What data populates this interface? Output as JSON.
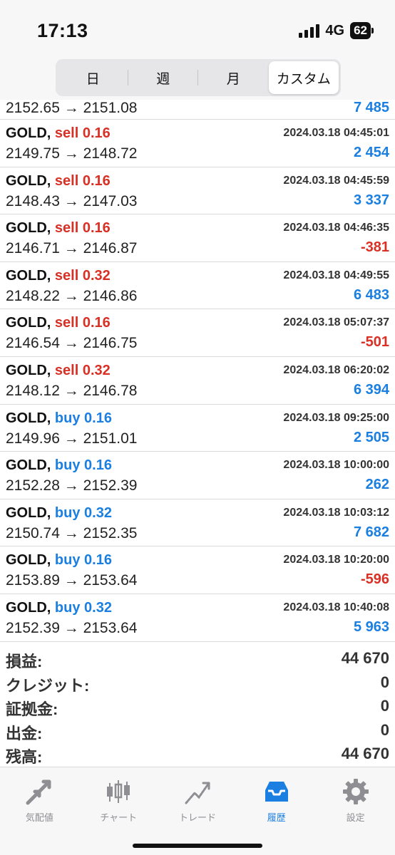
{
  "status_bar": {
    "time": "17:13",
    "network": "4G",
    "battery": "62"
  },
  "period_tabs": [
    {
      "label": "日",
      "active": false
    },
    {
      "label": "週",
      "active": false
    },
    {
      "label": "月",
      "active": false
    },
    {
      "label": "カスタム",
      "active": true
    }
  ],
  "partial_row": {
    "prices": "2152.65 → 2151.08",
    "profit": "7 485"
  },
  "deals": [
    {
      "symbol": "GOLD,",
      "side": "sell 0.16",
      "type": "sell",
      "time": "2024.03.18 04:45:01",
      "prices": "2149.75 → 2148.72",
      "profit": "2 454",
      "sign": "pos"
    },
    {
      "symbol": "GOLD,",
      "side": "sell 0.16",
      "type": "sell",
      "time": "2024.03.18 04:45:59",
      "prices": "2148.43 → 2147.03",
      "profit": "3 337",
      "sign": "pos"
    },
    {
      "symbol": "GOLD,",
      "side": "sell 0.16",
      "type": "sell",
      "time": "2024.03.18 04:46:35",
      "prices": "2146.71 → 2146.87",
      "profit": "-381",
      "sign": "neg"
    },
    {
      "symbol": "GOLD,",
      "side": "sell 0.32",
      "type": "sell",
      "time": "2024.03.18 04:49:55",
      "prices": "2148.22 → 2146.86",
      "profit": "6 483",
      "sign": "pos"
    },
    {
      "symbol": "GOLD,",
      "side": "sell 0.16",
      "type": "sell",
      "time": "2024.03.18 05:07:37",
      "prices": "2146.54 → 2146.75",
      "profit": "-501",
      "sign": "neg"
    },
    {
      "symbol": "GOLD,",
      "side": "sell 0.32",
      "type": "sell",
      "time": "2024.03.18 06:20:02",
      "prices": "2148.12 → 2146.78",
      "profit": "6 394",
      "sign": "pos"
    },
    {
      "symbol": "GOLD,",
      "side": "buy 0.16",
      "type": "buy",
      "time": "2024.03.18 09:25:00",
      "prices": "2149.96 → 2151.01",
      "profit": "2 505",
      "sign": "pos"
    },
    {
      "symbol": "GOLD,",
      "side": "buy 0.16",
      "type": "buy",
      "time": "2024.03.18 10:00:00",
      "prices": "2152.28 → 2152.39",
      "profit": "262",
      "sign": "pos"
    },
    {
      "symbol": "GOLD,",
      "side": "buy 0.32",
      "type": "buy",
      "time": "2024.03.18 10:03:12",
      "prices": "2150.74 → 2152.35",
      "profit": "7 682",
      "sign": "pos"
    },
    {
      "symbol": "GOLD,",
      "side": "buy 0.16",
      "type": "buy",
      "time": "2024.03.18 10:20:00",
      "prices": "2153.89 → 2153.64",
      "profit": "-596",
      "sign": "neg"
    },
    {
      "symbol": "GOLD,",
      "side": "buy 0.32",
      "type": "buy",
      "time": "2024.03.18 10:40:08",
      "prices": "2152.39 → 2153.64",
      "profit": "5 963",
      "sign": "pos"
    }
  ],
  "summary": [
    {
      "label": "損益:",
      "value": "44 670"
    },
    {
      "label": "クレジット:",
      "value": "0"
    },
    {
      "label": "証拠金:",
      "value": "0"
    },
    {
      "label": "出金:",
      "value": "0"
    },
    {
      "label": "残高:",
      "value": "44 670"
    }
  ],
  "tab_bar": [
    {
      "label": "気配値",
      "icon": "quotes-arrows-icon",
      "active": false
    },
    {
      "label": "チャート",
      "icon": "candlestick-chart-icon",
      "active": false
    },
    {
      "label": "トレード",
      "icon": "trade-trend-icon",
      "active": false
    },
    {
      "label": "履歴",
      "icon": "history-inbox-icon",
      "active": true
    },
    {
      "label": "設定",
      "icon": "gear-icon",
      "active": false
    }
  ],
  "colors": {
    "sell": "#d93025",
    "buy": "#1a7fe0",
    "profit_positive": "#1a7fe0",
    "profit_negative": "#d93025",
    "active_tab": "#1a7fe0",
    "inactive_tab": "#8e8e93"
  }
}
